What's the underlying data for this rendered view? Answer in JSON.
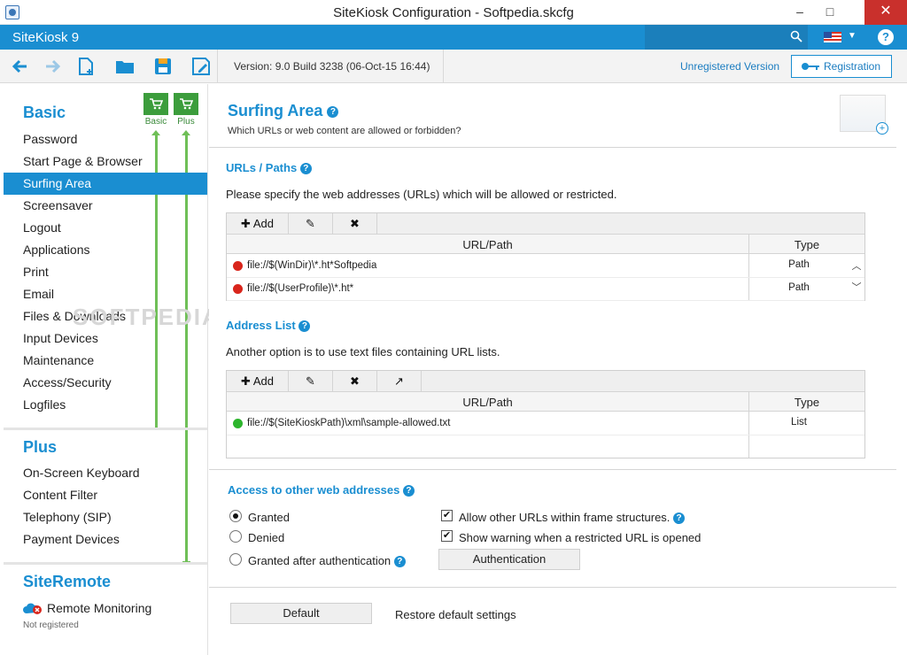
{
  "window": {
    "title": "SiteKiosk Configuration - Softpedia.skcfg",
    "minimize": "–",
    "maximize": "□",
    "close": "✕"
  },
  "appbar": {
    "name": "SiteKiosk 9",
    "help": "?"
  },
  "toolbar": {
    "version": "Version: 9.0 Build 3238 (06-Oct-15 16:44)",
    "unregistered": "Unregistered Version",
    "registration": "Registration"
  },
  "sidebar": {
    "basic_title": "Basic",
    "plus_title": "Plus",
    "remote_title": "SiteRemote",
    "level_basic": "Basic",
    "level_plus": "Plus",
    "basic_items": [
      "Password",
      "Start Page & Browser",
      "Surfing Area",
      "Screensaver",
      "Logout",
      "Applications",
      "Print",
      "Email",
      "Files & Downloads",
      "Input Devices",
      "Maintenance",
      "Access/Security",
      "Logfiles"
    ],
    "plus_items": [
      "On-Screen Keyboard",
      "Content Filter",
      "Telephony (SIP)",
      "Payment Devices"
    ],
    "remote_item": "Remote Monitoring",
    "remote_status": "Not registered",
    "watermark": "SOFTPEDIA"
  },
  "main": {
    "title": "Surfing Area",
    "subtitle": "Which URLs or web content are allowed or forbidden?",
    "urls": {
      "heading": "URLs / Paths",
      "description": "Please specify the web addresses (URLs) which will be allowed or restricted.",
      "add_label": "Add",
      "col_path": "URL/Path",
      "col_type": "Type",
      "rows": [
        {
          "path": "file://$(WinDir)\\*.ht*Softpedia",
          "type": "Path",
          "status_color": "#d9261c"
        },
        {
          "path": "file://$(UserProfile)\\*.ht*",
          "type": "Path",
          "status_color": "#d9261c"
        }
      ]
    },
    "address_list": {
      "heading": "Address List",
      "description": "Another option is to use text files containing URL lists.",
      "add_label": "Add",
      "col_path": "URL/Path",
      "col_type": "Type",
      "rows": [
        {
          "path": "file://$(SiteKioskPath)\\xml\\sample-allowed.txt",
          "type": "List",
          "status_color": "#2db52d"
        }
      ]
    },
    "access": {
      "heading": "Access to other web addresses",
      "granted": "Granted",
      "denied": "Denied",
      "granted_auth": "Granted after authentication",
      "selected": "granted",
      "allow_frames": "Allow other URLs within frame structures.",
      "show_warning": "Show warning when a restricted URL is opened",
      "auth_button": "Authentication"
    },
    "footer": {
      "default_button": "Default",
      "restore_label": "Restore default settings"
    }
  },
  "colors": {
    "accent": "#1a8ed1",
    "level": "#3c9d3c",
    "deny": "#d9261c",
    "allow": "#2db52d"
  }
}
